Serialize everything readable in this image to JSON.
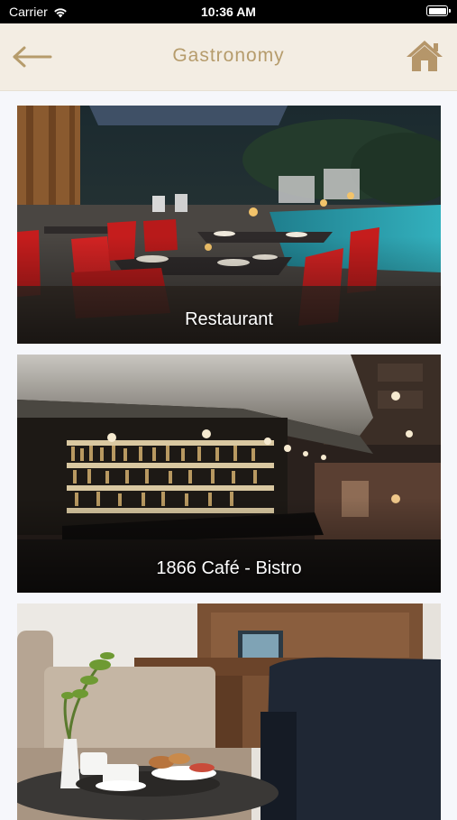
{
  "status_bar": {
    "carrier": "Carrier",
    "time": "10:36 AM",
    "battery_level": 1.0
  },
  "header": {
    "title": "Gastronomy",
    "back_icon": "arrow-left-icon",
    "home_icon": "home-icon",
    "accent_color": "#b69c6c",
    "background": "#f3ede3"
  },
  "venues": [
    {
      "label": "Restaurant"
    },
    {
      "label": "1866 Café - Bistro"
    },
    {
      "label": ""
    }
  ]
}
